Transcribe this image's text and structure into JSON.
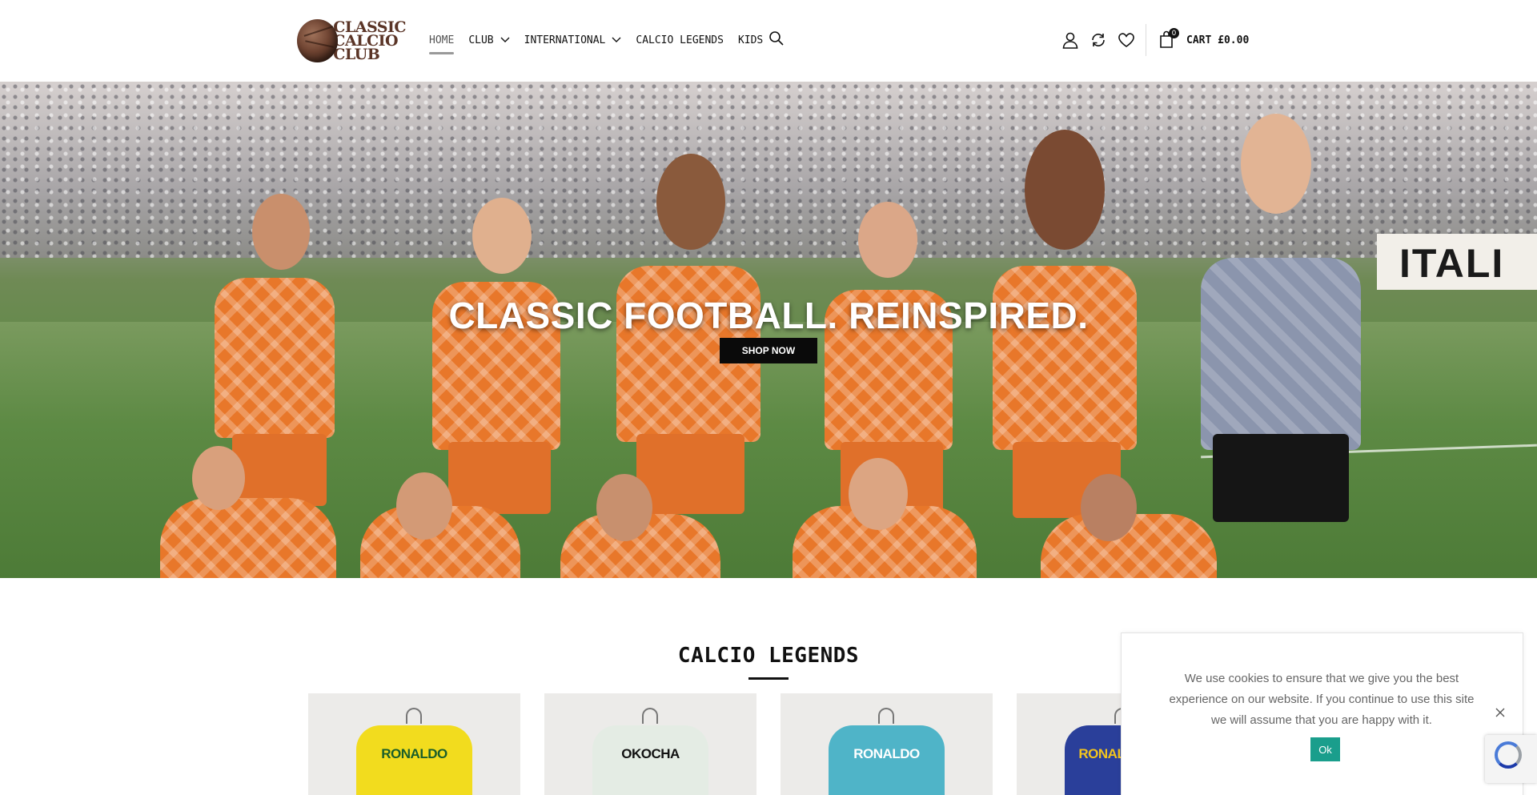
{
  "header": {
    "logo": {
      "line1": "CLASSIC",
      "line2": "CALCIO",
      "line3": "CLUB"
    },
    "nav": [
      {
        "label": "HOME",
        "active": true,
        "dropdown": false
      },
      {
        "label": "CLUB",
        "active": false,
        "dropdown": true
      },
      {
        "label": "INTERNATIONAL",
        "active": false,
        "dropdown": true
      },
      {
        "label": "CALCIO LEGENDS",
        "active": false,
        "dropdown": false
      },
      {
        "label": "KIDS",
        "active": false,
        "dropdown": false
      }
    ],
    "icons": [
      "search-icon",
      "account-icon",
      "compare-icon",
      "wishlist-icon",
      "cart-icon"
    ],
    "cart": {
      "count": "0",
      "label": "CART £0.00"
    }
  },
  "hero": {
    "title": "CLASSIC FOOTBALL. REINSPIRED.",
    "cta": "SHOP NOW",
    "board_text": "ITALI"
  },
  "legends": {
    "title": "CALCIO LEGENDS",
    "products": [
      {
        "name": "RONALDO",
        "color": "#f2dc1e",
        "text_color": "#1a5e2a"
      },
      {
        "name": "OKOCHA",
        "color": "#e4ece4",
        "text_color": "#111111"
      },
      {
        "name": "RONALDO",
        "color": "#4fb4c8",
        "text_color": "#ffffff"
      },
      {
        "name": "RONALDINHO",
        "color": "#2a3f9a",
        "text_color": "#f2c41e"
      }
    ]
  },
  "cookie": {
    "text": "We use cookies to ensure that we give you the best experience on our website. If you continue to use this site we will assume that you are happy with it.",
    "ok": "Ok"
  },
  "colors": {
    "accent": "#1a9e8c",
    "cta": "#0a0a0a",
    "brand": "#5a3426"
  }
}
